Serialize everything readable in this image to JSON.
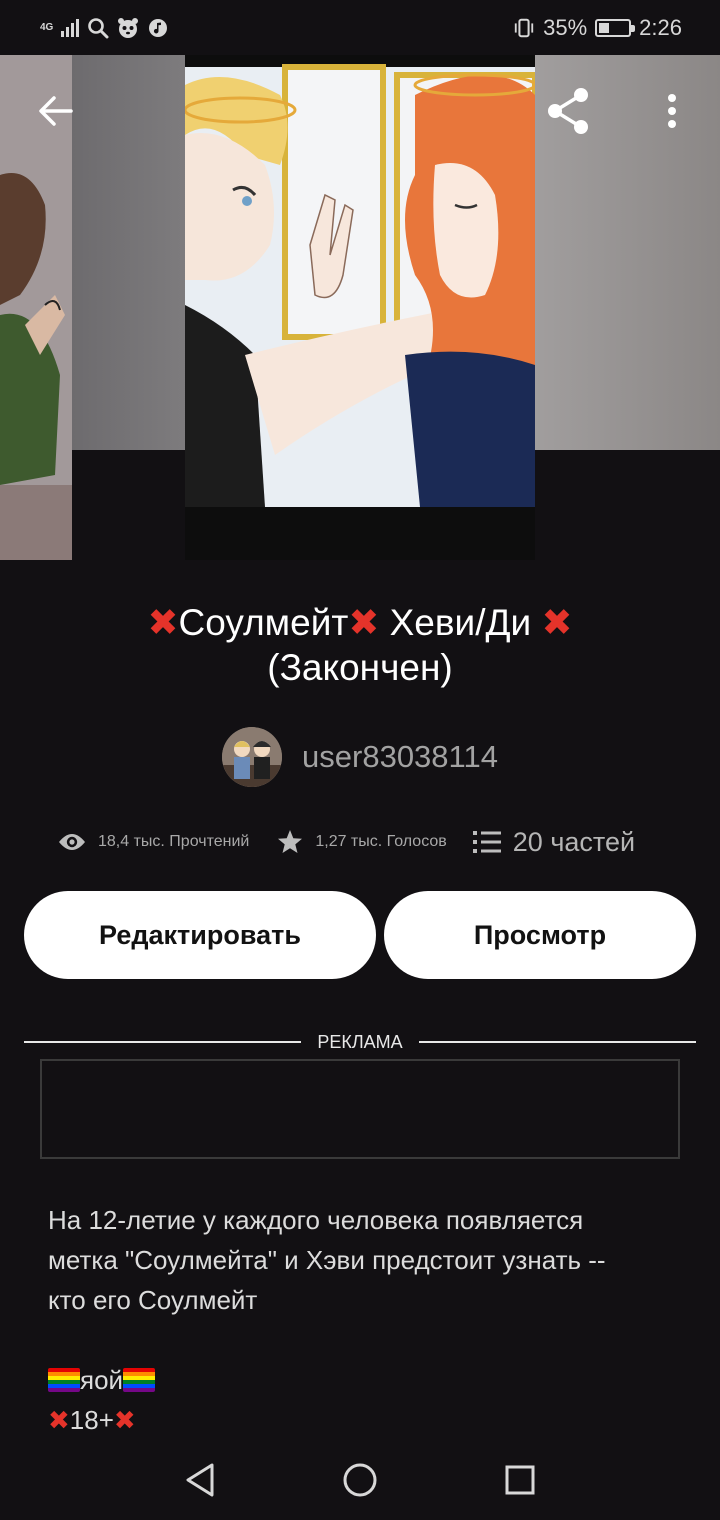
{
  "status_bar": {
    "network": "4G",
    "battery_percent": "35%",
    "battery_level": 0.35,
    "time": "2:26",
    "icons": [
      "signal-icon",
      "search-icon",
      "panda-icon",
      "music-icon",
      "vibrate-icon",
      "battery-icon"
    ]
  },
  "toolbar": {
    "back_icon": "arrow-left-icon",
    "share_icon": "share-icon",
    "more_icon": "more-vertical-icon"
  },
  "story": {
    "title_line1": "❌Соулмейт❌ Хеви/Ди ❌",
    "title_line2": "(Закончен)",
    "author": "user83038114",
    "reads": "18,4 тыс. Прочтений",
    "votes": "1,27 тыс. Голосов",
    "parts": "20 частей"
  },
  "actions": {
    "edit_label": "Редактировать",
    "view_label": "Просмотр"
  },
  "ad": {
    "label": "РЕКЛАМА"
  },
  "description": {
    "line1": "На 12-летие у каждого человека появляется",
    "line2": "метка \"Соулмейта\" и Хэви предстоит узнать --",
    "line3": "кто его Соулмейт",
    "tag1_text": "яой",
    "tag2_text": "18+"
  },
  "nav": {
    "back": "triangle-back-icon",
    "home": "circle-home-icon",
    "recents": "square-recents-icon"
  },
  "colors": {
    "background": "#121013",
    "button_bg": "#ffffff",
    "accent_red": "#e5332a"
  }
}
